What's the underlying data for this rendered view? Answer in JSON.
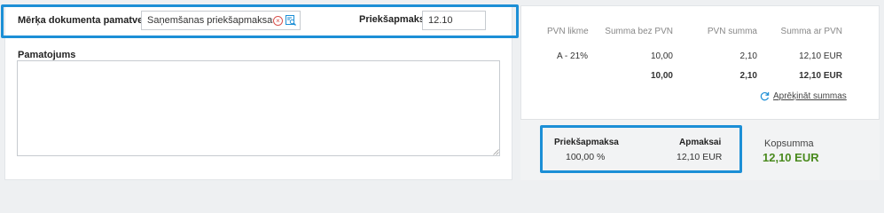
{
  "form": {
    "purpose_label": "Mērķa dokumenta pamatveids",
    "purpose_value": "Saņemšanas priekšapmaksas ...",
    "prepayment_label": "Priekšapmaksa",
    "prepayment_value": "12.10",
    "reason_label": "Pamatojums",
    "reason_value": ""
  },
  "vat_table": {
    "headers": [
      "PVN likme",
      "Summa bez PVN",
      "PVN summa",
      "Summa ar PVN"
    ],
    "row": {
      "rate": "A - 21%",
      "net": "10,00",
      "vat": "2,10",
      "gross": "12,10 EUR"
    },
    "totals": {
      "net": "10,00",
      "vat": "2,10",
      "gross": "12,10 EUR"
    },
    "recalc_label": "Aprēķināt summas"
  },
  "footer": {
    "prepayment_label": "Priekšapmaksa",
    "prepayment_pct": "100,00 %",
    "payment_label": "Apmaksai",
    "payment_value": "12,10 EUR",
    "total_label": "Kopsumma",
    "total_value": "12,10 EUR"
  },
  "colors": {
    "accent": "#1c8fd6",
    "total_green": "#4a8a1e",
    "clear_red": "#d9534f"
  }
}
